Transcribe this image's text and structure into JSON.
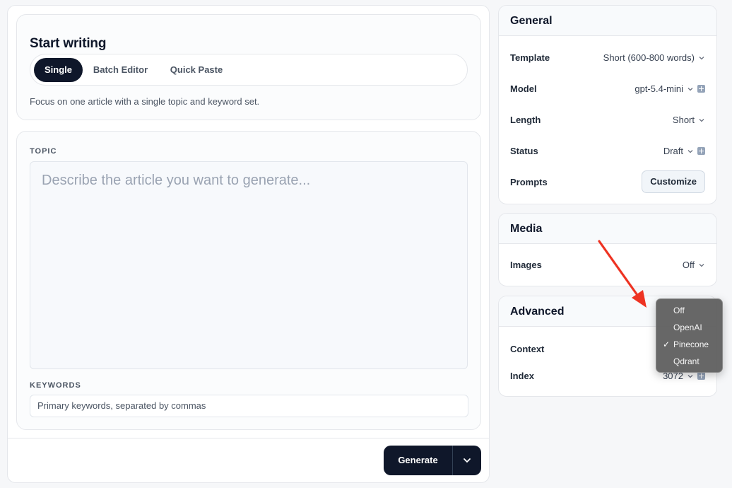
{
  "start": {
    "title": "Start writing",
    "tabs": [
      "Single",
      "Batch Editor",
      "Quick Paste"
    ],
    "description": "Focus on one article with a single topic and keyword set."
  },
  "form": {
    "topic_label": "TOPIC",
    "topic_placeholder": "Describe the article you want to generate...",
    "keywords_label": "KEYWORDS",
    "keywords_placeholder": "Primary keywords, separated by commas"
  },
  "actions": {
    "generate_label": "Generate"
  },
  "general": {
    "title": "General",
    "template_label": "Template",
    "template_value": "Short (600-800 words)",
    "model_label": "Model",
    "model_value": "gpt-5.4-mini",
    "length_label": "Length",
    "length_value": "Short",
    "status_label": "Status",
    "status_value": "Draft",
    "prompts_label": "Prompts",
    "customize_label": "Customize"
  },
  "media": {
    "title": "Media",
    "images_label": "Images",
    "images_value": "Off"
  },
  "advanced": {
    "title": "Advanced",
    "context_label": "Context",
    "index_label": "Index",
    "index_value": "3072"
  },
  "dropdown": {
    "options": [
      "Off",
      "OpenAI",
      "Pinecone",
      "Qdrant"
    ],
    "selected": "Pinecone",
    "check_glyph": "✓"
  },
  "colors": {
    "accent": "#0f172a",
    "annotation_arrow": "#ee3322"
  }
}
